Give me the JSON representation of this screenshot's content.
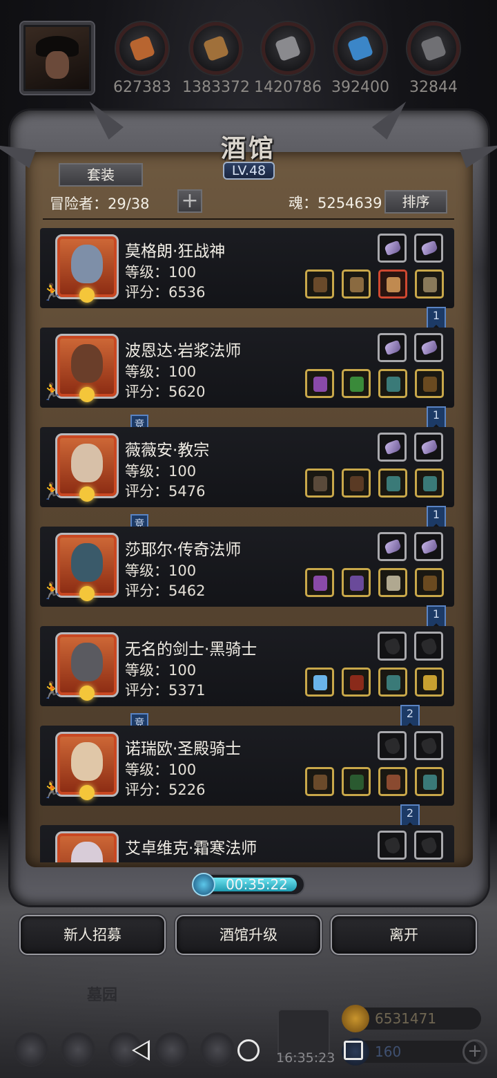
{
  "resources": [
    {
      "name": "meat",
      "value": "627383",
      "color": "#b86530"
    },
    {
      "name": "wood",
      "value": "1383372",
      "color": "#a0703a"
    },
    {
      "name": "iron",
      "value": "1420786",
      "color": "#8a8a8e"
    },
    {
      "name": "crystal",
      "value": "392400",
      "color": "#3b86c8"
    },
    {
      "name": "stone",
      "value": "32844",
      "color": "#707074"
    }
  ],
  "tavern": {
    "title": "酒馆",
    "level": "LV.48",
    "suit_label": "套装",
    "adventurers_label": "冒险者：29/38",
    "add_label": "+",
    "soul_label": "魂：5254639",
    "sort_label": "排序"
  },
  "heroes": [
    {
      "name": "莫格朗·狂战神",
      "level": "等级：100",
      "score": "评分：6536",
      "face": "#7e8fa8",
      "upper": "gem",
      "equip": [
        "axe",
        "armor",
        "orb-red",
        "helm"
      ],
      "badge": "1",
      "contest": ""
    },
    {
      "name": "波恩达·岩浆法师",
      "level": "等级：100",
      "score": "评分：5620",
      "face": "#6a3e2a",
      "upper": "gem",
      "equip": [
        "staff",
        "robe",
        "ring",
        "bow"
      ],
      "badge": "1",
      "contest": "竞"
    },
    {
      "name": "薇薇安·教宗",
      "level": "等级：100",
      "score": "评分：5476",
      "face": "#d7c0a8",
      "upper": "gem",
      "equip": [
        "hammer",
        "cloak",
        "ring",
        "ring"
      ],
      "badge": "1",
      "contest": "竞"
    },
    {
      "name": "莎耶尔·传奇法师",
      "level": "等级：100",
      "score": "评分：5462",
      "face": "#3a5a6a",
      "upper": "gem",
      "equip": [
        "staff",
        "armor-purple",
        "cloth",
        "bow"
      ],
      "badge": "1",
      "contest": ""
    },
    {
      "name": "无名的剑士·黑骑士",
      "level": "等级：100",
      "score": "评分：5371",
      "face": "#5a5a60",
      "upper": "glove",
      "equip": [
        "sword",
        "armor-red",
        "ring",
        "ring-gold"
      ],
      "badge": "2",
      "contest": "竞"
    },
    {
      "name": "诺瑞欧·圣殿骑士",
      "level": "等级：100",
      "score": "评分：5226",
      "face": "#e0c7a8",
      "upper": "glove",
      "equip": [
        "axe",
        "cloak-green",
        "boot",
        "ring"
      ],
      "badge": "2",
      "contest": ""
    },
    {
      "name": "艾卓维克·霜寒法师",
      "level": "",
      "score": "",
      "face": "#d8ccd8",
      "upper": "glove",
      "equip": [],
      "badge": "",
      "contest": ""
    }
  ],
  "timer": "00:35:22",
  "actions": {
    "recruit": "新人招募",
    "upgrade": "酒馆升级",
    "leave": "离开"
  },
  "hud": {
    "location": "墓园",
    "clock": "16:35:23",
    "gold": "6531471",
    "diamond": "160"
  }
}
